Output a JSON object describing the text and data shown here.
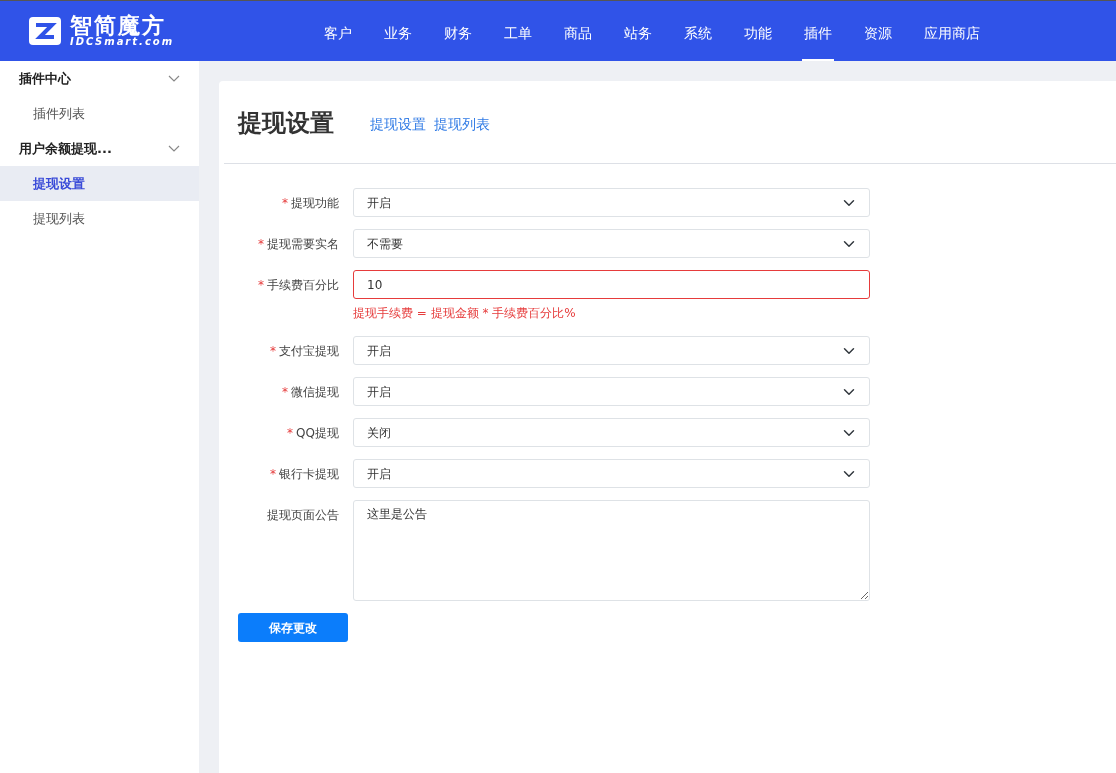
{
  "logo": {
    "name": "智简魔方",
    "subtitle": "IDCSmart.com"
  },
  "nav": [
    {
      "label": "客户",
      "selected": false
    },
    {
      "label": "业务",
      "selected": false
    },
    {
      "label": "财务",
      "selected": false
    },
    {
      "label": "工单",
      "selected": false
    },
    {
      "label": "商品",
      "selected": false
    },
    {
      "label": "站务",
      "selected": false
    },
    {
      "label": "系统",
      "selected": false
    },
    {
      "label": "功能",
      "selected": false
    },
    {
      "label": "插件",
      "selected": true
    },
    {
      "label": "资源",
      "selected": false
    },
    {
      "label": "应用商店",
      "selected": false
    }
  ],
  "sidebar": {
    "groups": [
      {
        "label": "插件中心",
        "expanded": true,
        "children": [
          {
            "label": "插件列表",
            "selected": false
          }
        ]
      },
      {
        "label": "用户余额提现...",
        "expanded": true,
        "children": [
          {
            "label": "提现设置",
            "selected": true
          },
          {
            "label": "提现列表",
            "selected": false
          }
        ]
      }
    ]
  },
  "page": {
    "title": "提现设置",
    "links": [
      "提现设置",
      "提现列表"
    ]
  },
  "form": {
    "fields": [
      {
        "kind": "select",
        "required_mark": "*",
        "label": "提现功能",
        "value": "开启"
      },
      {
        "kind": "select",
        "required_mark": "*",
        "label": "提现需要实名",
        "value": "不需要"
      },
      {
        "kind": "input",
        "required_mark": "*",
        "label": "手续费百分比",
        "value": "10",
        "invalid": true,
        "help": "提现手续费 = 提现金额 * 手续费百分比%"
      },
      {
        "kind": "select",
        "required_mark": "*",
        "label": "支付宝提现",
        "value": "开启"
      },
      {
        "kind": "select",
        "required_mark": "*",
        "label": "微信提现",
        "value": "开启"
      },
      {
        "kind": "select",
        "required_mark": "*",
        "label": "QQ提现",
        "value": "关闭"
      },
      {
        "kind": "select",
        "required_mark": "*",
        "label": "银行卡提现",
        "value": "开启"
      },
      {
        "kind": "textarea",
        "label": "提现页面公告",
        "value": "这里是公告"
      }
    ],
    "submit": "保存更改"
  }
}
